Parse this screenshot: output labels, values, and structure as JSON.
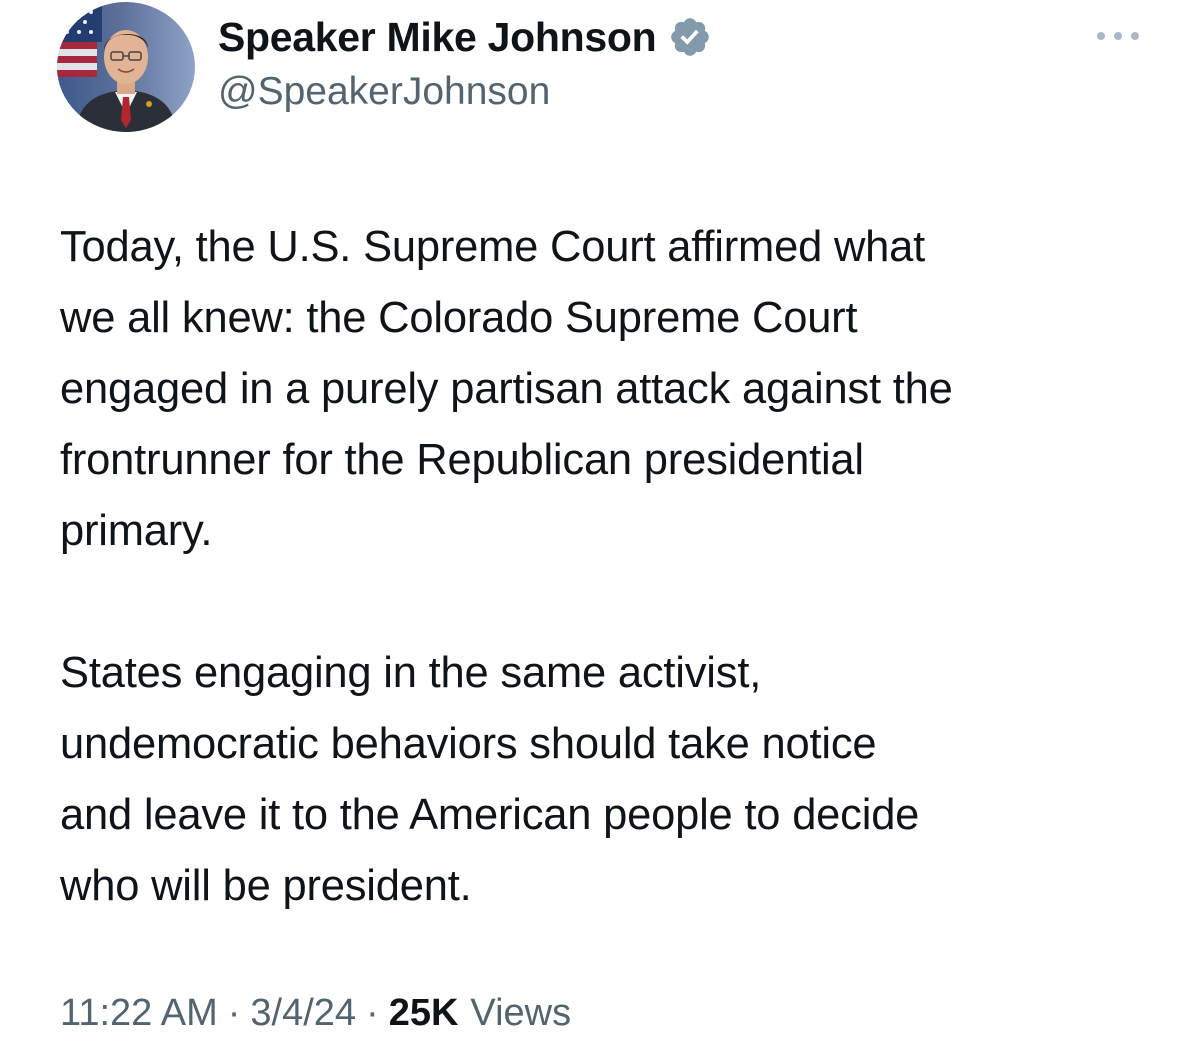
{
  "author": {
    "display_name": "Speaker Mike Johnson",
    "handle": "@SpeakerJohnson",
    "verified_icon": "verified-badge-icon",
    "verified_color": "#829aab"
  },
  "menu": {
    "icon": "more-options-icon"
  },
  "tweet": {
    "paragraphs": [
      "Today, the U.S. Supreme Court affirmed what\nwe all knew: the Colorado Supreme Court\nengaged in a purely partisan attack against the\nfrontrunner for the Republican presidential\nprimary.",
      "States engaging in the same activist,\nundemocratic behaviors should take notice\nand leave it to the American people to decide\nwho will be president."
    ]
  },
  "meta": {
    "time": "11:22 AM",
    "separator": "·",
    "date": "3/4/24",
    "views_count": "25K",
    "views_label": "Views"
  },
  "colors": {
    "text_primary": "#0f1419",
    "text_secondary": "#536471",
    "background": "#ffffff"
  }
}
